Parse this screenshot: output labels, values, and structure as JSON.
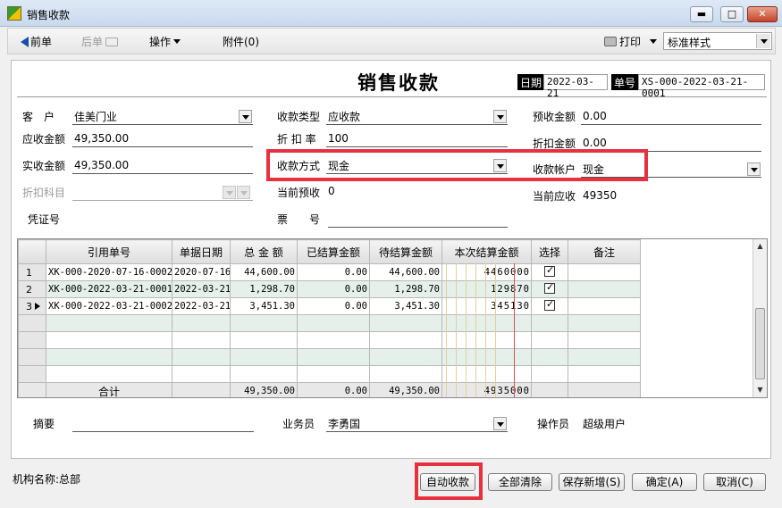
{
  "window": {
    "title": "销售收款",
    "minimize_label": "▬",
    "maximize_label": "□",
    "close_label": "✕"
  },
  "toolbar": {
    "prev": "前单",
    "next": "后单",
    "ops": "操作",
    "attach": "附件(0)",
    "print": "打印",
    "style_select": "标准样式"
  },
  "form": {
    "title": "销售收款",
    "date_label": "日期",
    "date_value": "2022-03-21",
    "no_label": "单号",
    "no_value": "XS-000-2022-03-21-0001",
    "customer_label": "客　户",
    "customer_value": "佳美门业",
    "receivable_label": "应收金额",
    "receivable_value": "49,350.00",
    "actual_label": "实收金额",
    "actual_value": "49,350.00",
    "discount_subject_label": "折扣科目",
    "voucher_label": "凭证号",
    "collect_type_label": "收款类型",
    "collect_type_value": "应收款",
    "discount_rate_label": "折 扣 率",
    "discount_rate_value": "100",
    "pay_method_label": "收款方式",
    "pay_method_value": "现金",
    "current_prepaid_label": "当前预收",
    "current_prepaid_value": "0",
    "ticket_label": "票　　号",
    "prepaid_amount_label": "预收金额",
    "prepaid_amount_value": "0.00",
    "discount_amount_label": "折扣金额",
    "discount_amount_value": "0.00",
    "account_label": "收款帐户",
    "account_value": "现金",
    "current_receivable_label": "当前应收",
    "current_receivable_value": "49350",
    "summary_label": "摘要",
    "salesman_label": "业务员",
    "salesman_value": "李勇国",
    "operator_label": "操作员",
    "operator_value": "超级用户"
  },
  "grid": {
    "columns": [
      "引用单号",
      "单据日期",
      "总 金 额",
      "已结算金额",
      "待结算金额",
      "本次结算金额",
      "选择",
      "备注"
    ],
    "rows": [
      {
        "num": "1",
        "ref": "XK-000-2020-07-16-0002",
        "date": "2020-07-16",
        "total": "44,600.00",
        "settled": "0.00",
        "pending": "44,600.00",
        "this": "4460000",
        "checked": true
      },
      {
        "num": "2",
        "ref": "XK-000-2022-03-21-0001",
        "date": "2022-03-21",
        "total": "1,298.70",
        "settled": "0.00",
        "pending": "1,298.70",
        "this": "129870",
        "checked": true
      },
      {
        "num": "3",
        "ref": "XK-000-2022-03-21-0002",
        "date": "2022-03-21",
        "total": "3,451.30",
        "settled": "0.00",
        "pending": "3,451.30",
        "this": "345130",
        "checked": true
      }
    ],
    "total_row": {
      "label": "合计",
      "total": "49,350.00",
      "settled": "0.00",
      "pending": "49,350.00",
      "this": "4935000"
    }
  },
  "footer": {
    "org_label": "机构名称:总部",
    "auto_collect": "自动收款",
    "clear_all": "全部清除",
    "save_new": "保存新增(S)",
    "confirm": "确定(A)",
    "cancel": "取消(C)"
  },
  "colors": {
    "highlight": "#e8313f",
    "row_alt": "#e6f0ea"
  }
}
